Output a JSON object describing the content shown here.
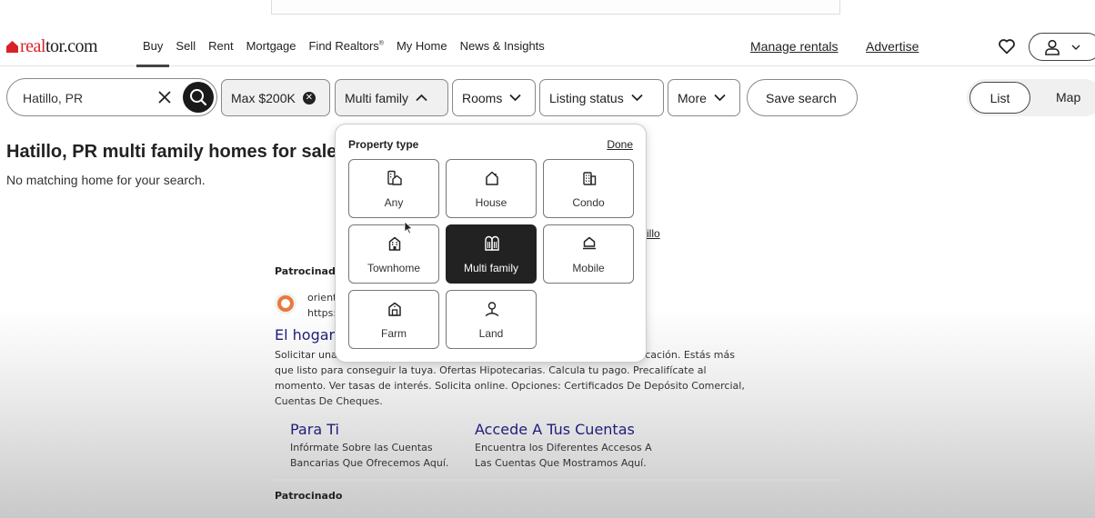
{
  "header": {
    "logo_text_red": "real",
    "logo_text_dark": "tor.com",
    "nav": [
      {
        "label": "Buy",
        "active": true
      },
      {
        "label": "Sell",
        "active": false
      },
      {
        "label": "Rent",
        "active": false
      },
      {
        "label": "Mortgage",
        "active": false
      },
      {
        "label": "Find Realtors",
        "sup": "®",
        "active": false
      },
      {
        "label": "My Home",
        "active": false
      },
      {
        "label": "News & Insights",
        "active": false
      }
    ],
    "manage_rentals": "Manage rentals",
    "advertise": "Advertise",
    "icons": {
      "favorites": "heart-icon",
      "user": "user-icon",
      "user_menu": "chevron-down-icon"
    }
  },
  "filters": {
    "search_value": "Hatillo, PR",
    "clear_icon": "close-icon",
    "search_icon": "search-icon",
    "price_chip": "Max $200K",
    "property_chip": "Multi family",
    "rooms_chip": "Rooms",
    "listing_status_chip": "Listing status",
    "more_chip": "More",
    "save_search": "Save search",
    "view_list": "List",
    "view_map": "Map",
    "active_view": "List"
  },
  "results": {
    "title": "Hatillo, PR multi family homes for sale",
    "subtitle": "No matching home for your search.",
    "partial_link": "illo"
  },
  "property_dropdown": {
    "title": "Property type",
    "done": "Done",
    "selected": "Multi family",
    "options": [
      {
        "label": "Any",
        "icon": "any-property-icon"
      },
      {
        "label": "House",
        "icon": "house-icon"
      },
      {
        "label": "Condo",
        "icon": "condo-icon"
      },
      {
        "label": "Townhome",
        "icon": "townhome-icon"
      },
      {
        "label": "Multi family",
        "icon": "multi-family-icon"
      },
      {
        "label": "Mobile",
        "icon": "mobile-home-icon"
      },
      {
        "label": "Farm",
        "icon": "farm-icon"
      },
      {
        "label": "Land",
        "icon": "land-icon"
      }
    ]
  },
  "ad": {
    "sponsored": "Patrocinado",
    "advertiser_line1": "orient",
    "advertiser_line2": "https:",
    "headline": "El hogar",
    "desc_line1_start": "Solicitar una",
    "desc_line1_end": "icación. Estás más",
    "desc_rest": "que listo para conseguir la tuya. Ofertas Hipotecarias. Calcula tu pago. Precalifícate al momento. Ver tasas de interés. Solicita online. Opciones: Certificados De Depósito Comercial, Cuentas De Cheques.",
    "sitelinks": [
      {
        "title": "Para Ti",
        "desc1": "Infórmate Sobre las Cuentas",
        "desc2": "Bancarias Que Ofrecemos Aquí."
      },
      {
        "title": "Accede A Tus Cuentas",
        "desc1": "Encuentra los Diferentes Accesos A",
        "desc2": "Las Cuentas Que Mostramos Aquí."
      }
    ],
    "sponsored_2": "Patrocinado"
  }
}
